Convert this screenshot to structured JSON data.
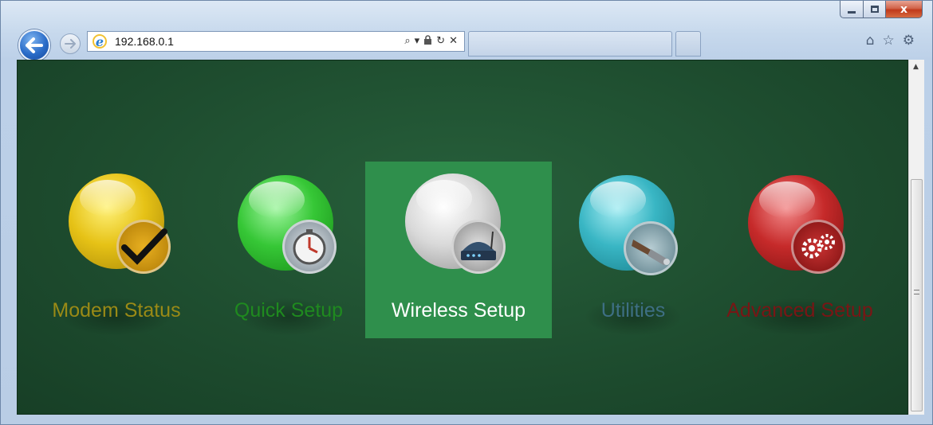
{
  "browser": {
    "address": "192.168.0.1",
    "caption": {
      "minimize_glyph": "",
      "maximize_glyph": "",
      "close_glyph": "x"
    },
    "icons": {
      "back": "back-arrow-icon",
      "forward": "forward-arrow-icon",
      "ie": "ie-logo-icon",
      "search": "⌕",
      "dropdown": "▾",
      "lock": "🔒",
      "refresh": "↻",
      "stop": "✕",
      "home": "⌂",
      "favorites": "☆",
      "settings": "⚙"
    }
  },
  "menu": {
    "items": [
      {
        "label": "Modem Status",
        "color": "#9a8a16",
        "orb_color": "#e6c216",
        "icon": "checkmark-icon",
        "glyph": "✔",
        "badge_color": "#c99a12"
      },
      {
        "label": "Quick Setup",
        "color": "#1f8a1f",
        "orb_color": "#36c736",
        "icon": "stopwatch-icon",
        "glyph": "⏱",
        "badge_color": "#6c7b86"
      },
      {
        "label": "Wireless Setup",
        "color": "#ffffff",
        "orb_color": "#e8e8e8",
        "icon": "router-icon",
        "glyph": "▭",
        "badge_color": "#3f5f86",
        "selected": true
      },
      {
        "label": "Utilities",
        "color": "#3e6f84",
        "orb_color": "#39b6c4",
        "icon": "wrench-icon",
        "glyph": "🔧",
        "badge_color": "#5d7f8a"
      },
      {
        "label": "Advanced Setup",
        "color": "#7a1515",
        "orb_color": "#c62a2a",
        "icon": "gears-icon",
        "glyph": "⚙",
        "badge_color": "#a11d1d"
      }
    ]
  }
}
